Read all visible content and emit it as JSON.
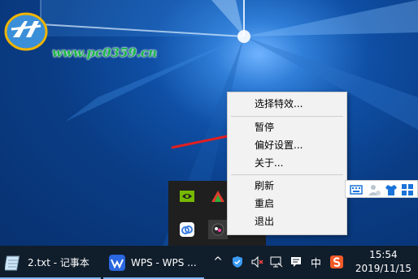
{
  "watermark": {
    "text": "www.pc0359.cn"
  },
  "context_menu": {
    "items": [
      {
        "label": "选择特效..."
      },
      {
        "label": "暂停"
      },
      {
        "label": "偏好设置..."
      },
      {
        "label": "关于..."
      },
      {
        "label": "刷新"
      },
      {
        "label": "重启"
      },
      {
        "label": "退出"
      }
    ]
  },
  "tray_flyout": {
    "icons": [
      "nvidia-icon",
      "colorful-app-icon",
      "cloud-icon",
      "wallpaper-app-icon"
    ]
  },
  "ime_toolbar": {
    "icons": [
      "keyboard-icon",
      "user-icon",
      "shirt-icon",
      "grid-icon"
    ]
  },
  "taskbar": {
    "tasks": [
      {
        "label": "2.txt - 记事本",
        "icon": "notepad-icon"
      },
      {
        "label": "WPS - WPS ...",
        "icon": "wps-icon"
      }
    ],
    "tray": {
      "chevron": "^",
      "ime_label": "中",
      "time": "15:54",
      "date": "2019/11/15"
    }
  },
  "colors": {
    "taskbar": "#101d2b",
    "menu_bg": "#f2f2f2",
    "arrow": "#e21f1f",
    "watermark_green": "#1db74a"
  }
}
